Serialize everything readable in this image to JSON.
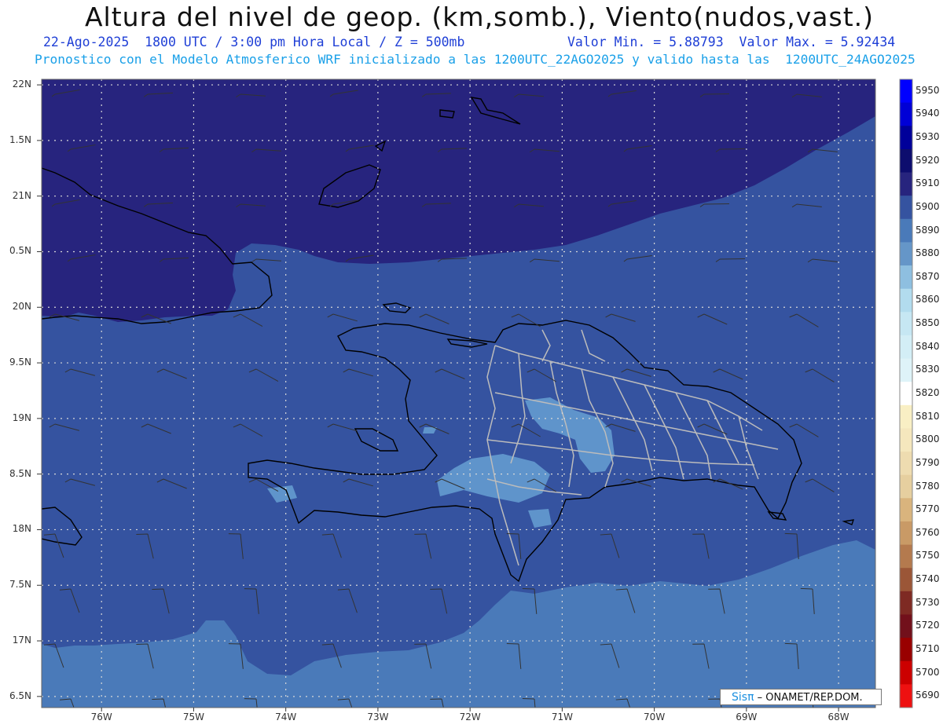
{
  "header": {
    "title": "Altura del nivel de geop. (km,somb.), Viento(nudos,vast.)",
    "line1_left": "22-Ago-2025  1800 UTC / 3:00 pm Hora Local / Z = 500mb",
    "line1_right": "Valor Min. = 5.88793  Valor Max. = 5.92434",
    "line2": "Pronostico con el Modelo Atmosferico WRF inicializado a las 1200UTC_22AGO2025 y valido hasta las  1200UTC_24AGO2025"
  },
  "map": {
    "lon_range": [
      -76.65,
      -67.6
    ],
    "lat_range": [
      16.4,
      22.05
    ],
    "y_ticks": [
      {
        "lat": 22.0,
        "label": "22N"
      },
      {
        "lat": 21.5,
        "label": "1.5N"
      },
      {
        "lat": 21.0,
        "label": "21N"
      },
      {
        "lat": 20.5,
        "label": "0.5N"
      },
      {
        "lat": 20.0,
        "label": "20N"
      },
      {
        "lat": 19.5,
        "label": "9.5N"
      },
      {
        "lat": 19.0,
        "label": "19N"
      },
      {
        "lat": 18.5,
        "label": "8.5N"
      },
      {
        "lat": 18.0,
        "label": "18N"
      },
      {
        "lat": 17.5,
        "label": "7.5N"
      },
      {
        "lat": 17.0,
        "label": "17N"
      },
      {
        "lat": 16.5,
        "label": "6.5N"
      }
    ],
    "x_ticks": [
      {
        "lon": -76,
        "label": "76W"
      },
      {
        "lon": -75,
        "label": "75W"
      },
      {
        "lon": -74,
        "label": "74W"
      },
      {
        "lon": -73,
        "label": "73W"
      },
      {
        "lon": -72,
        "label": "72W"
      },
      {
        "lon": -71,
        "label": "71W"
      },
      {
        "lon": -70,
        "label": "70W"
      },
      {
        "lon": -69,
        "label": "69W"
      },
      {
        "lon": -68,
        "label": "68W"
      }
    ],
    "shading_colors": {
      "5910_5920": "#27247e",
      "5900_5910": "#3553a0",
      "5890_5900": "#4a7ab9",
      "5880_5890": "#5f94cb"
    }
  },
  "colorbar": {
    "levels": [
      {
        "value": "5950",
        "color": "#0000ff"
      },
      {
        "value": "5940",
        "color": "#0000d6"
      },
      {
        "value": "5930",
        "color": "#00009a"
      },
      {
        "value": "5920",
        "color": "#0d0d6e"
      },
      {
        "value": "5910",
        "color": "#27247e"
      },
      {
        "value": "5900",
        "color": "#3553a0"
      },
      {
        "value": "5890",
        "color": "#4a7ab9"
      },
      {
        "value": "5880",
        "color": "#6596c8"
      },
      {
        "value": "5870",
        "color": "#8ebfe0"
      },
      {
        "value": "5860",
        "color": "#b2dcee"
      },
      {
        "value": "5850",
        "color": "#c6e7f3"
      },
      {
        "value": "5840",
        "color": "#d3eef6"
      },
      {
        "value": "5830",
        "color": "#def3f8"
      },
      {
        "value": "5820",
        "color": "#ffffff"
      },
      {
        "value": "5810",
        "color": "#f9efc4"
      },
      {
        "value": "5800",
        "color": "#f5e7bd"
      },
      {
        "value": "5790",
        "color": "#eedcb0"
      },
      {
        "value": "5780",
        "color": "#e6cf9f"
      },
      {
        "value": "5770",
        "color": "#d9b47d"
      },
      {
        "value": "5760",
        "color": "#c99a66"
      },
      {
        "value": "5750",
        "color": "#b47a4e"
      },
      {
        "value": "5740",
        "color": "#9b5637"
      },
      {
        "value": "5730",
        "color": "#7e2a23"
      },
      {
        "value": "5720",
        "color": "#72101b"
      },
      {
        "value": "5710",
        "color": "#990000"
      },
      {
        "value": "5700",
        "color": "#cc0000"
      },
      {
        "value": "5690",
        "color": "#ee1111"
      }
    ]
  },
  "credit": {
    "logo": "Sisπ",
    "text": " – ONAMET/REP.DOM."
  }
}
